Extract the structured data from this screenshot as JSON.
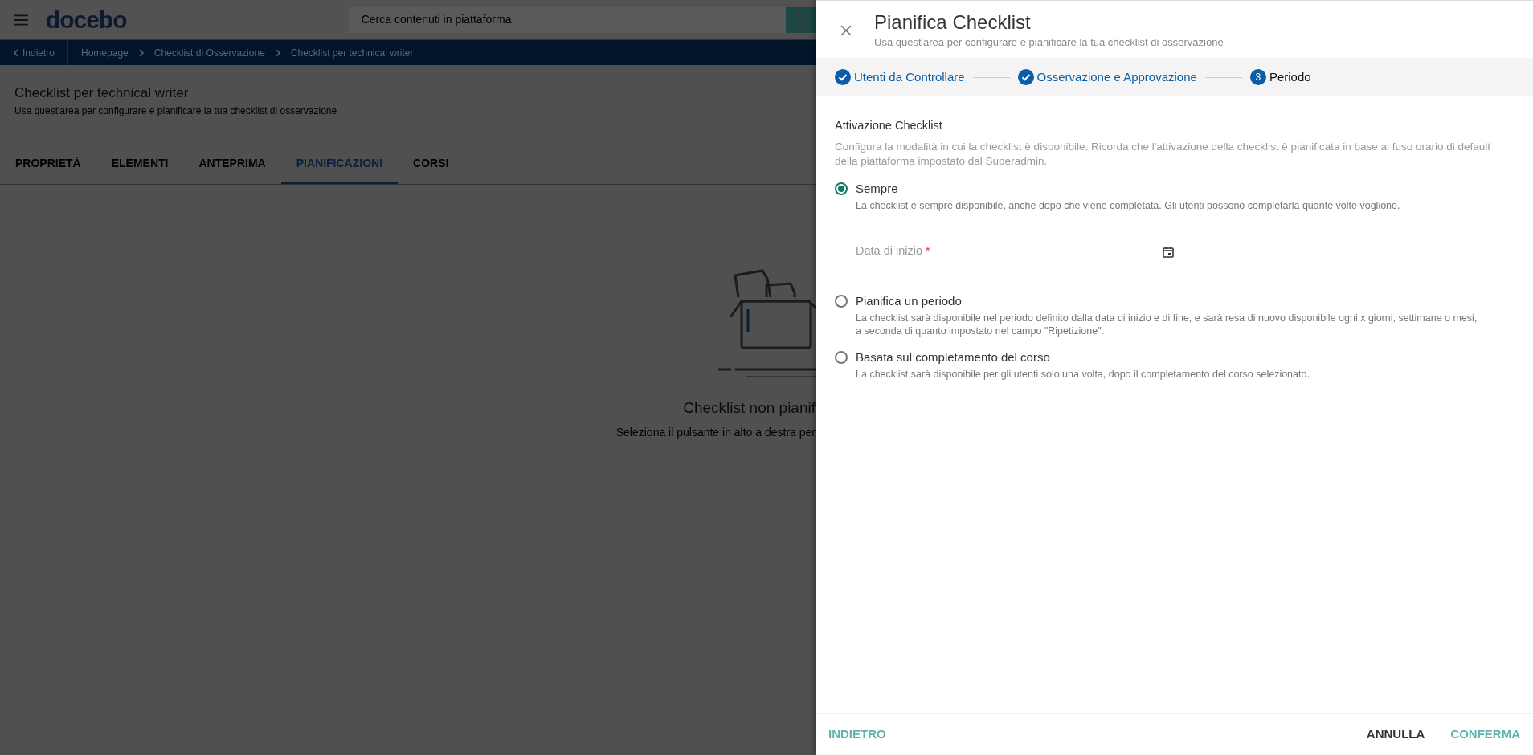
{
  "background": {
    "logo": "docebo",
    "search": {
      "placeholder": "Cerca contenuti in piattaforma"
    },
    "breadcrumb": {
      "back": "Indietro",
      "items": [
        "Homepage",
        "Checklist di Osservazione",
        "Checklist per technical writer"
      ]
    },
    "page_title": "Checklist per technical writer",
    "page_subtitle": "Usa quest'area per configurare e pianificare la tua checklist di osservazione",
    "tabs": [
      {
        "label": "PROPRIETÀ",
        "selected": false
      },
      {
        "label": "ELEMENTI",
        "selected": false
      },
      {
        "label": "ANTEPRIMA",
        "selected": false
      },
      {
        "label": "PIANIFICAZIONI",
        "selected": true
      },
      {
        "label": "CORSI",
        "selected": false
      }
    ],
    "empty_state": {
      "title": "Checklist non pianif",
      "text": "Seleziona il pulsante in alto a destra per"
    }
  },
  "panel": {
    "title": "Pianifica Checklist",
    "subtitle": "Usa quest'area per configurare e pianificare la tua checklist di osservazione",
    "steps": [
      {
        "label": "Utenti da Controllare",
        "completed": true,
        "selected": false
      },
      {
        "label": "Osservazione e Approvazione",
        "completed": true,
        "selected": false
      },
      {
        "label": "Periodo",
        "number": "3",
        "completed": false,
        "selected": true
      }
    ],
    "section_title": "Attivazione Checklist",
    "section_text": "Configura la modalità in cui la checklist è disponibile. Ricorda che l'attivazione della checklist è pianificata in base al fuso orario di default della piattaforma impostato dal Superadmin.",
    "options": [
      {
        "label": "Sempre",
        "description": "La checklist è sempre disponibile, anche dopo che viene completata. Gli utenti possono completarla quante volte vogliono.",
        "selected": true,
        "date_field": {
          "label": "Data di inizio",
          "required_mark": "*"
        }
      },
      {
        "label": "Pianifica un periodo",
        "description": "La checklist sarà disponibile nel periodo definito dalla data di inizio e di fine, e sarà resa di nuovo disponibile ogni x giorni, settimane o mesi, a seconda di quanto impostato nel campo \"Ripetizione\".",
        "selected": false
      },
      {
        "label": "Basata sul completamento del corso",
        "description": "La checklist sarà disponibile per gli utenti solo una volta, dopo il completamento del corso selezionato.",
        "selected": false
      }
    ],
    "footer": {
      "back": "INDIETRO",
      "cancel": "ANNULLA",
      "confirm": "CONFERMA"
    }
  }
}
